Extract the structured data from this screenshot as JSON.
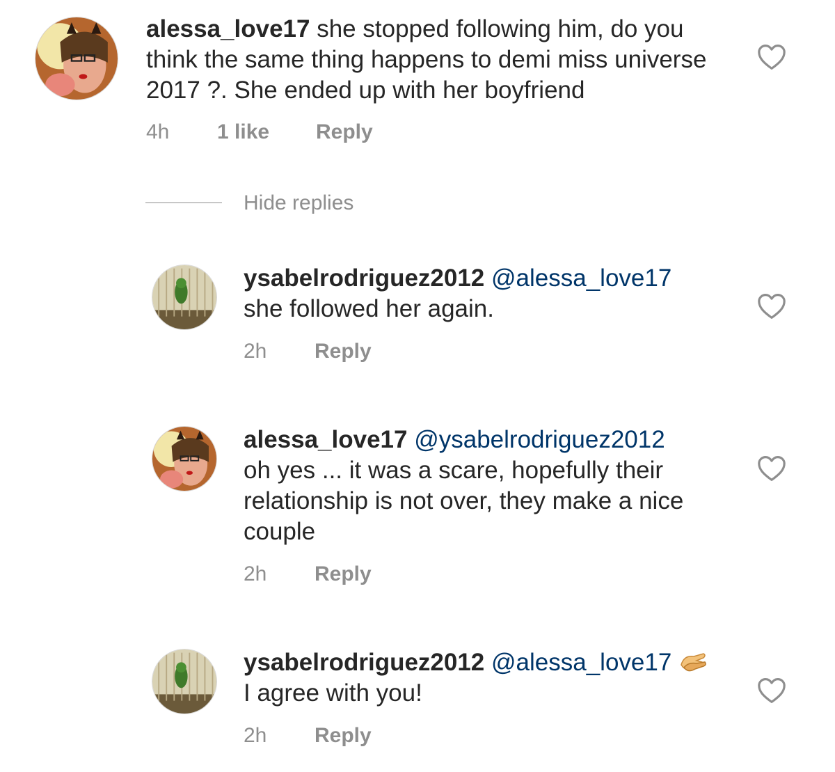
{
  "comments": [
    {
      "username": "alessa_love17",
      "mention": "",
      "text": "she stopped following him, do you think the same thing happens to demi miss universe 2017 ?. She ended up with her boyfriend",
      "time": "4h",
      "likes": "1 like",
      "reply_label": "Reply",
      "avatar": "avatar-alessa-cat-ears",
      "icon": "heart-outline-icon"
    }
  ],
  "hide_replies_label": "Hide replies",
  "replies": [
    {
      "username": "ysabelrodriguez2012",
      "mention": "@alessa_love17",
      "text": "she followed her again.",
      "time": "2h",
      "reply_label": "Reply",
      "avatar": "avatar-parrot-cage",
      "icon": "heart-outline-icon"
    },
    {
      "username": "alessa_love17",
      "mention": "@ysabelrodriguez2012",
      "text": "oh yes ... it was a scare, hopefully their relationship is not over, they make a nice couple",
      "time": "2h",
      "reply_label": "Reply",
      "avatar": "avatar-alessa-cat-ears",
      "icon": "heart-outline-icon"
    },
    {
      "username": "ysabelrodriguez2012",
      "mention": "@alessa_love17",
      "emoji": "clapping-hands-emoji",
      "text": "I agree with you!",
      "time": "2h",
      "reply_label": "Reply",
      "avatar": "avatar-parrot-cage",
      "icon": "heart-outline-icon"
    }
  ],
  "colors": {
    "text": "#262626",
    "meta": "#8e8e8e",
    "mention": "#003569",
    "divider": "#c7c7c7",
    "heart": "#8e8e8e"
  }
}
